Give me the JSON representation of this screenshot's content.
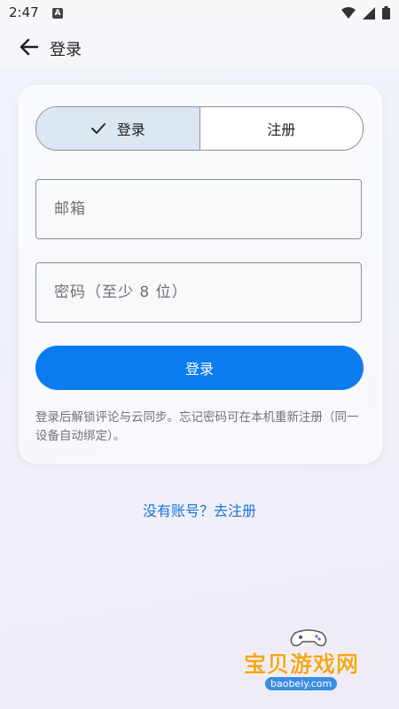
{
  "status_bar": {
    "time": "2:47",
    "notification_badge": "A",
    "icons": [
      "wifi-icon",
      "signal-icon",
      "battery-icon"
    ]
  },
  "app_bar": {
    "title": "登录",
    "back_icon": "arrow-left-icon"
  },
  "tabs": [
    {
      "label": "登录",
      "active": true,
      "icon": "check-icon"
    },
    {
      "label": "注册",
      "active": false
    }
  ],
  "form": {
    "email": {
      "placeholder": "邮箱",
      "value": ""
    },
    "password": {
      "placeholder": "密码（至少 8 位）",
      "value": ""
    },
    "submit_label": "登录",
    "hint": "登录后解锁评论与云同步。忘记密码可在本机重新注册（同一设备自动绑定）。"
  },
  "register_link": "没有账号？去注册",
  "watermark": {
    "text": "宝贝游戏网",
    "url": "baobeiy.com"
  },
  "colors": {
    "primary": "#0a7cf0",
    "link": "#1b74d8",
    "tab_active_bg": "#dde6f3"
  }
}
